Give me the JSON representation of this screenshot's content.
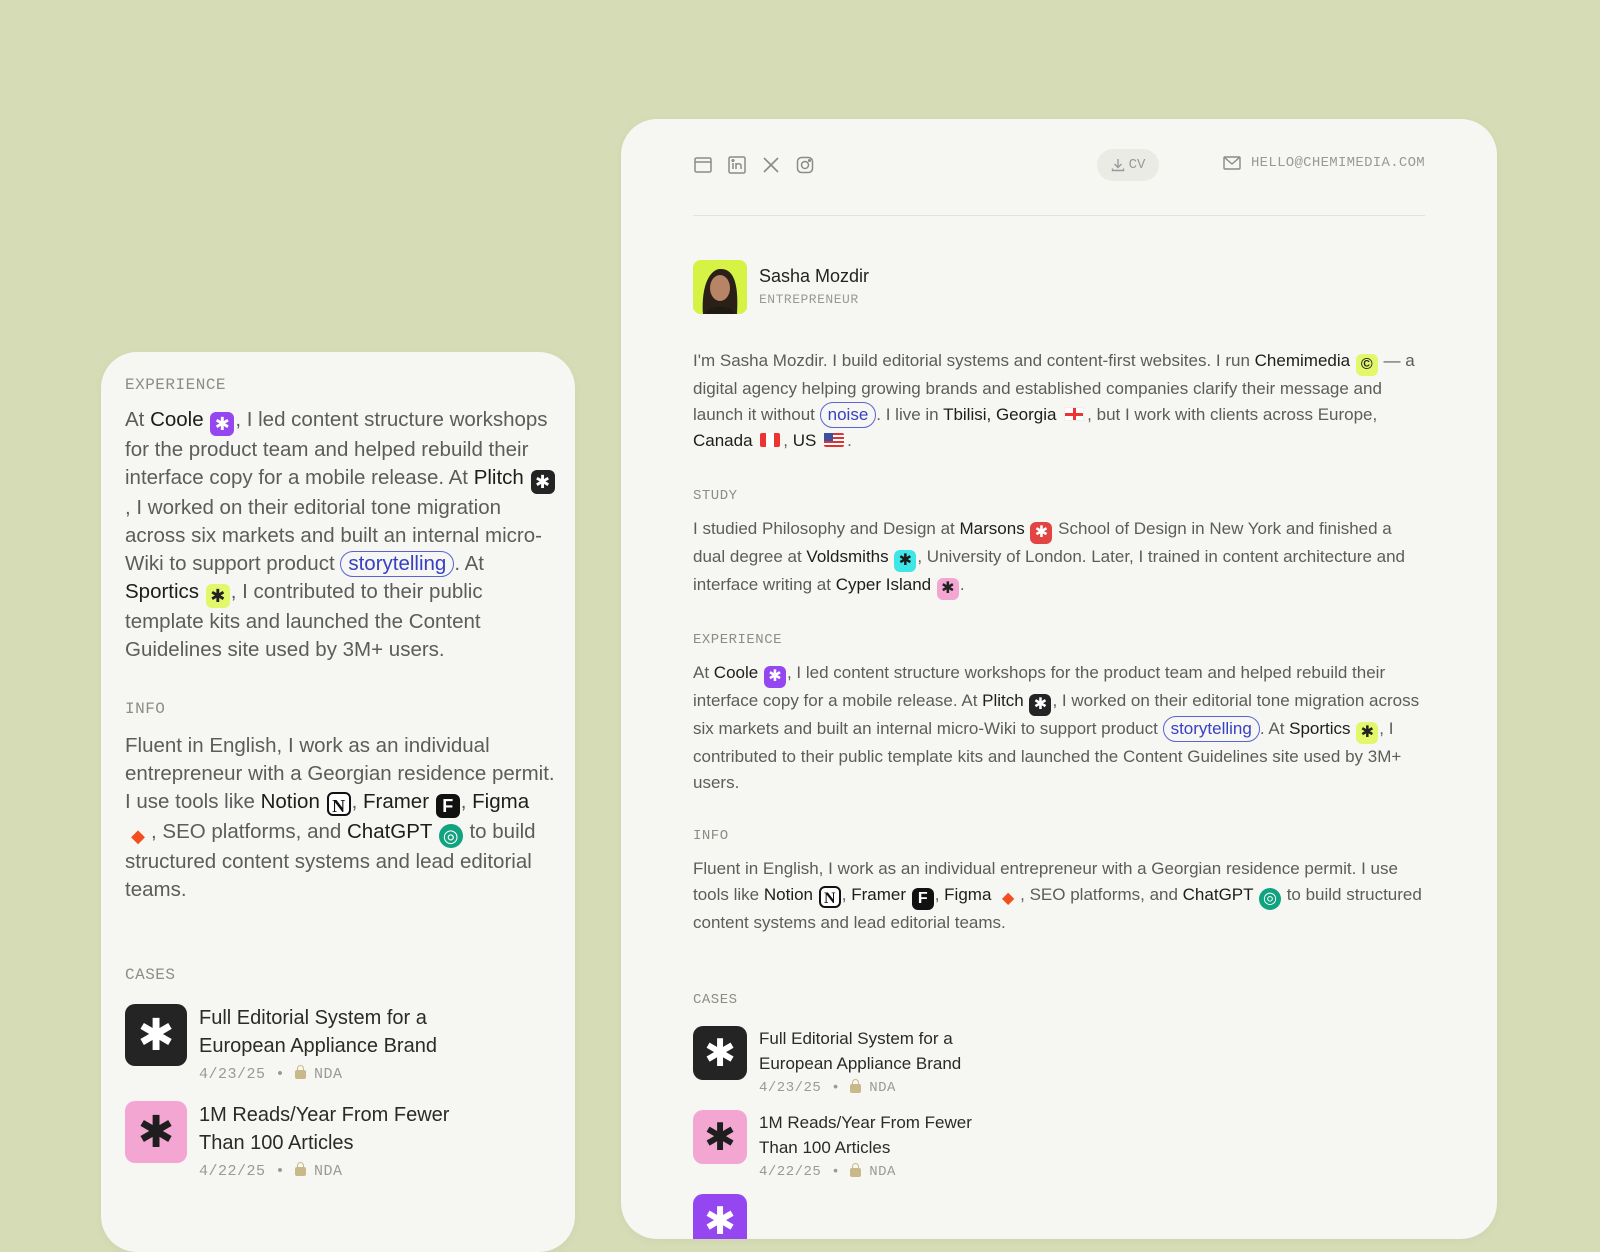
{
  "colors": {
    "background": "#d6dcb5",
    "card": "#f6f6f2",
    "pill": "#3740c4"
  },
  "header": {
    "social_icons": [
      "window-icon",
      "linkedin-icon",
      "x-icon",
      "instagram-icon"
    ],
    "cv_label": "CV",
    "email": "HELLO@CHEMIMEDIA.COM"
  },
  "profile": {
    "name": "Sasha Mozdir",
    "role": "ENTREPRENEUR"
  },
  "intro": {
    "t1": "I'm Sasha Mozdir. I build editorial systems and content-first websites. I run ",
    "chemimedia": "Chemimedia",
    "t2": " — a digital agency helping growing brands and established companies clarify their message and launch it without ",
    "noise": "noise",
    "t3": ". I live in ",
    "tbilisi": "Tbilisi, Georgia",
    "t4": ", but I work with clients across Europe, ",
    "canada": "Canada",
    "t5": ", ",
    "us": "US",
    "t6": "."
  },
  "study": {
    "label": "STUDY",
    "t1": "I studied Philosophy and Design at ",
    "marsons": "Marsons",
    "t2": " School of Design in New York and finished a dual degree at ",
    "voldsmiths": "Voldsmiths",
    "t3": ", University of London. Later, I trained in content architecture and interface writing at ",
    "cyper": "Cyper Island",
    "t4": "."
  },
  "experience": {
    "label": "EXPERIENCE",
    "t1": "At ",
    "coole": "Coole",
    "t2": ", I led content structure workshops for the product team and helped rebuild their interface copy for a mobile release. At ",
    "plitch": "Plitch",
    "t3": ", I worked on their editorial tone migration across six markets and built an internal micro-Wiki to support product ",
    "storytelling": "storytelling",
    "t4": ". At ",
    "sportics": "Sportics",
    "t5": ", I contributed to their public template kits and launched the Content Guidelines site used by 3M+ users."
  },
  "info": {
    "label": "INFO",
    "t1": "Fluent in English, I work as an individual entrepreneur with a Georgian residence permit. I use tools like ",
    "notion": "Notion",
    "t2": ", ",
    "framer": "Framer",
    "t3": ", ",
    "figma": "Figma",
    "t4": ", SEO platforms, and ",
    "chatgpt": "ChatGPT",
    "t5": " to build structured content systems and lead editorial teams."
  },
  "cases": {
    "label": "CASES",
    "items": [
      {
        "title": "Full Editorial System for a European Appliance Brand",
        "date": "4/23/25",
        "tag": "NDA",
        "color": "#242424"
      },
      {
        "title": "1M Reads/Year From Fewer Than 100 Articles",
        "date": "4/22/25",
        "tag": "NDA",
        "color": "#f3a6d2"
      }
    ]
  }
}
